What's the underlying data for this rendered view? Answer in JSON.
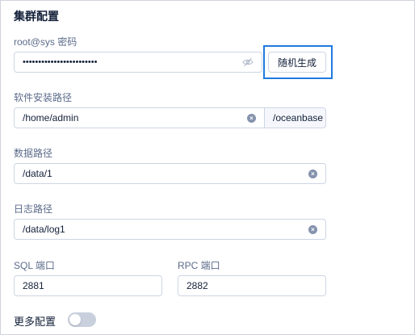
{
  "section": {
    "title": "集群配置"
  },
  "password": {
    "label": "root@sys 密码",
    "value": "••••••••••••••••••••••••",
    "icon": "eye-off-icon",
    "random_button": "随机生成"
  },
  "install_path": {
    "label": "软件安装路径",
    "value": "/home/admin",
    "suffix": "/oceanbase",
    "icon": "clear-icon"
  },
  "data_path": {
    "label": "数据路径",
    "value": "/data/1",
    "icon": "clear-icon"
  },
  "log_path": {
    "label": "日志路径",
    "value": "/data/log1",
    "icon": "clear-icon"
  },
  "sql_port": {
    "label": "SQL 端口",
    "value": "2881"
  },
  "rpc_port": {
    "label": "RPC 端口",
    "value": "2882"
  },
  "more": {
    "label": "更多配置",
    "enabled": false
  },
  "colors": {
    "highlight": "#1f7ae0",
    "toggle_off": "#c9d0dd"
  }
}
